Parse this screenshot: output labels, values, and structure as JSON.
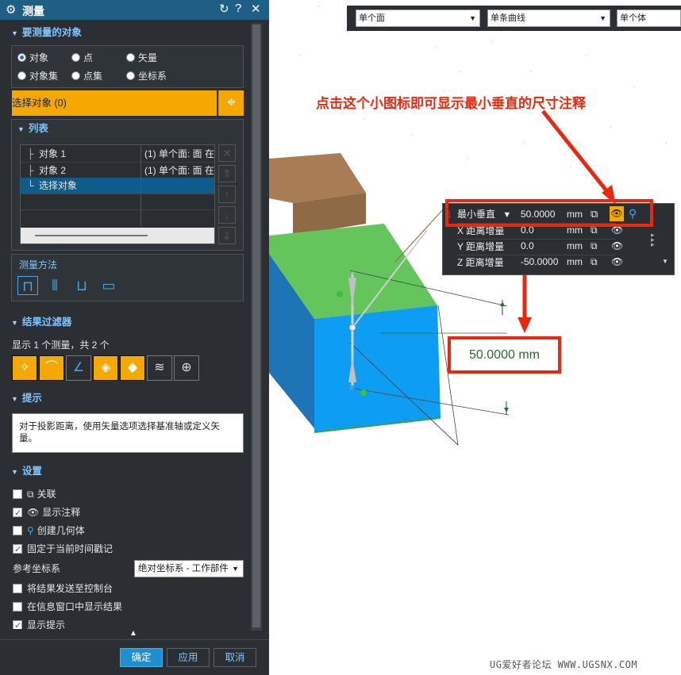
{
  "window": {
    "title": "测量"
  },
  "objects_section": {
    "header": "要测量的对象",
    "radios": [
      {
        "label": "对象",
        "selected": true
      },
      {
        "label": "点",
        "selected": false
      },
      {
        "label": "矢量",
        "selected": false
      },
      {
        "label": "对象集",
        "selected": false
      },
      {
        "label": "点集",
        "selected": false
      },
      {
        "label": "坐标系",
        "selected": false
      }
    ],
    "select_label": "选择对象 (0)"
  },
  "list_section": {
    "header": "列表",
    "rows": [
      {
        "name": "对象 1",
        "detail": "(1) 单个面: 面 在"
      },
      {
        "name": "对象 2",
        "detail": "(1) 单个面: 面 在"
      },
      {
        "name": "选择对象",
        "detail": ""
      }
    ]
  },
  "method_section": {
    "header": "测量方法"
  },
  "filter_section": {
    "header": "结果过滤器",
    "summary": "显示 1 个测量，共 2 个"
  },
  "hint_section": {
    "header": "提示",
    "text": "对于投影距离，使用矢量选项选择基准轴或定义矢量。"
  },
  "settings_section": {
    "header": "设置",
    "items": [
      {
        "label": "关联",
        "checked": false
      },
      {
        "label": "显示注释",
        "checked": true
      },
      {
        "label": "创建几何体",
        "checked": false
      },
      {
        "label": "固定于当前时间戳记",
        "checked": true
      }
    ],
    "ref_csys_label": "参考坐标系",
    "ref_csys_value": "绝对坐标系 - 工作部件",
    "items2": [
      {
        "label": "将结果发送至控制台",
        "checked": false
      },
      {
        "label": "在信息窗口中显示结果",
        "checked": false
      },
      {
        "label": "显示提示",
        "checked": true
      }
    ]
  },
  "footer": {
    "ok": "确定",
    "apply": "应用",
    "cancel": "取消"
  },
  "toolbar": {
    "filter1": "单个面",
    "filter2": "单条曲线",
    "filter3": "单个体"
  },
  "annotation": {
    "callout": "点击这个小图标即可显示最小垂直的尺寸注释"
  },
  "measurement_panel": {
    "rows": [
      {
        "label": "最小垂直",
        "value": "50.0000",
        "unit": "mm"
      },
      {
        "label": "X 距离增量",
        "value": "0.0",
        "unit": "mm"
      },
      {
        "label": "Y 距离增量",
        "value": "0.0",
        "unit": "mm"
      },
      {
        "label": "Z 距离增量",
        "value": "-50.0000",
        "unit": "mm"
      }
    ]
  },
  "dimension": {
    "label": "50.0000 mm"
  },
  "watermark": {
    "text": "UG爱好者论坛  WWW.UGSNX.COM"
  },
  "colors": {
    "accent": "#f4a800",
    "title_bar": "#1f5f86",
    "panel_bg": "#2b2f33",
    "highlight_red": "#e8290f",
    "cube_green": "#63c55c",
    "cube_blue": "#0d9ef3",
    "block_brown": "#a87c55"
  }
}
